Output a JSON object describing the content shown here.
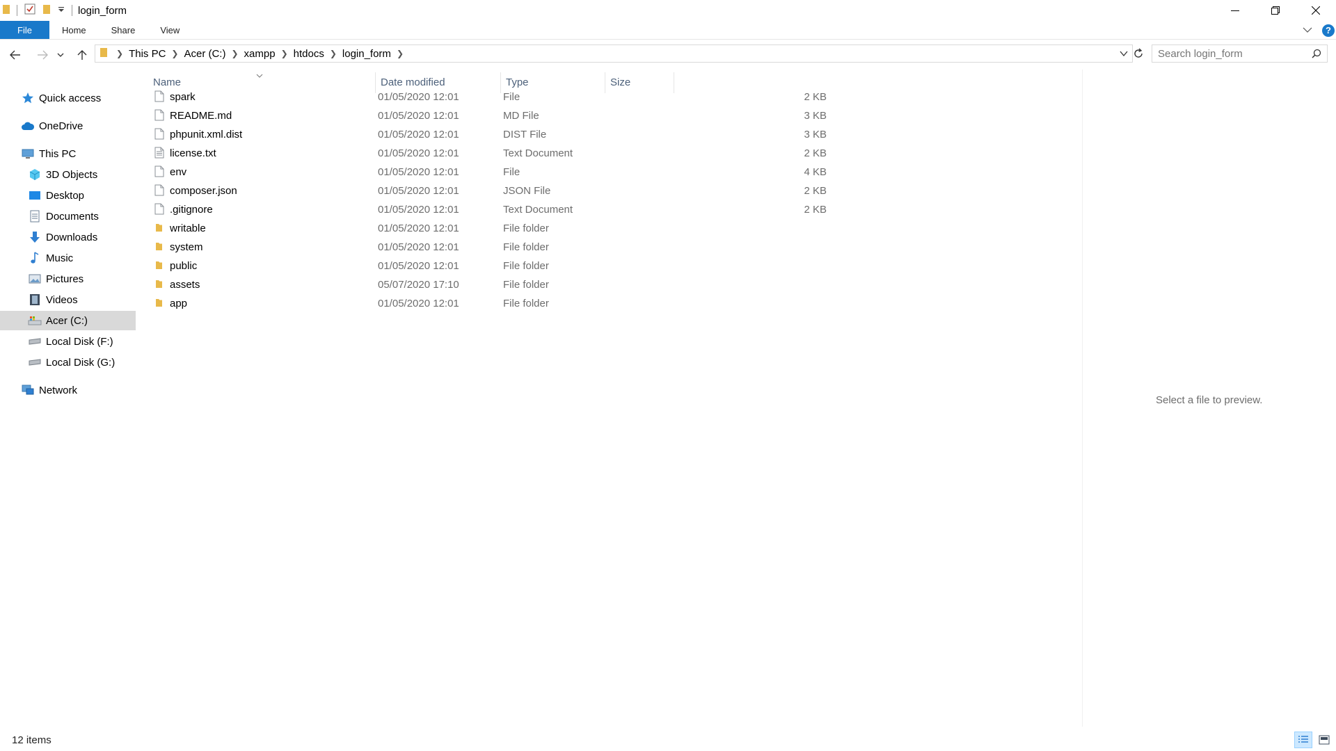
{
  "window": {
    "title": "login_form"
  },
  "ribbon": {
    "tabs": [
      "File",
      "Home",
      "Share",
      "View"
    ]
  },
  "address": {
    "crumbs": [
      "This PC",
      "Acer (C:)",
      "xampp",
      "htdocs",
      "login_form"
    ]
  },
  "search": {
    "placeholder": "Search login_form"
  },
  "sidebar": {
    "items": [
      {
        "label": "Quick access",
        "icon": "star-icon"
      },
      {
        "label": "OneDrive",
        "icon": "cloud-icon"
      },
      {
        "label": "This PC",
        "icon": "computer-icon"
      },
      {
        "label": "3D Objects",
        "icon": "cube-icon"
      },
      {
        "label": "Desktop",
        "icon": "desktop-icon"
      },
      {
        "label": "Documents",
        "icon": "document-icon"
      },
      {
        "label": "Downloads",
        "icon": "download-icon"
      },
      {
        "label": "Music",
        "icon": "music-icon"
      },
      {
        "label": "Pictures",
        "icon": "picture-icon"
      },
      {
        "label": "Videos",
        "icon": "video-icon"
      },
      {
        "label": "Acer (C:)",
        "icon": "drive-icon"
      },
      {
        "label": "Local Disk (F:)",
        "icon": "disk-icon"
      },
      {
        "label": "Local Disk (G:)",
        "icon": "disk-icon"
      },
      {
        "label": "Network",
        "icon": "network-icon"
      }
    ],
    "selected": "Acer (C:)"
  },
  "columns": {
    "name": "Name",
    "date": "Date modified",
    "type": "Type",
    "size": "Size"
  },
  "files": [
    {
      "name": "spark",
      "date": "01/05/2020 12:01",
      "type": "File",
      "size": "2 KB",
      "kind": "file"
    },
    {
      "name": "README.md",
      "date": "01/05/2020 12:01",
      "type": "MD File",
      "size": "3 KB",
      "kind": "file"
    },
    {
      "name": "phpunit.xml.dist",
      "date": "01/05/2020 12:01",
      "type": "DIST File",
      "size": "3 KB",
      "kind": "file"
    },
    {
      "name": "license.txt",
      "date": "01/05/2020 12:01",
      "type": "Text Document",
      "size": "2 KB",
      "kind": "text"
    },
    {
      "name": "env",
      "date": "01/05/2020 12:01",
      "type": "File",
      "size": "4 KB",
      "kind": "file"
    },
    {
      "name": "composer.json",
      "date": "01/05/2020 12:01",
      "type": "JSON File",
      "size": "2 KB",
      "kind": "file"
    },
    {
      "name": ".gitignore",
      "date": "01/05/2020 12:01",
      "type": "Text Document",
      "size": "2 KB",
      "kind": "file"
    },
    {
      "name": "writable",
      "date": "01/05/2020 12:01",
      "type": "File folder",
      "size": "",
      "kind": "folder"
    },
    {
      "name": "system",
      "date": "01/05/2020 12:01",
      "type": "File folder",
      "size": "",
      "kind": "folder"
    },
    {
      "name": "public",
      "date": "01/05/2020 12:01",
      "type": "File folder",
      "size": "",
      "kind": "folder"
    },
    {
      "name": "assets",
      "date": "05/07/2020 17:10",
      "type": "File folder",
      "size": "",
      "kind": "folder"
    },
    {
      "name": "app",
      "date": "01/05/2020 12:01",
      "type": "File folder",
      "size": "",
      "kind": "folder"
    }
  ],
  "preview": {
    "message": "Select a file to preview."
  },
  "status": {
    "count": "12 items"
  },
  "colors": {
    "accent": "#1979ca",
    "folder": "#e8b94a",
    "selected_bg": "#d9d9d9"
  }
}
